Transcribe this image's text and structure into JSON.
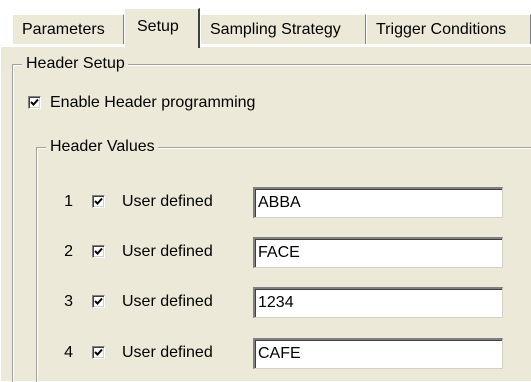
{
  "tabs": [
    {
      "label": "Parameters",
      "active": false
    },
    {
      "label": "Setup",
      "active": true
    },
    {
      "label": "Sampling Strategy",
      "active": false
    },
    {
      "label": "Trigger Conditions",
      "active": false
    }
  ],
  "header_setup": {
    "title": "Header Setup",
    "enable_label": "Enable Header programming",
    "enable_checked": true
  },
  "header_values": {
    "title": "Header Values",
    "rows": [
      {
        "num": "1",
        "label": "User defined",
        "checked": true,
        "value": "ABBA"
      },
      {
        "num": "2",
        "label": "User defined",
        "checked": true,
        "value": "FACE"
      },
      {
        "num": "3",
        "label": "User defined",
        "checked": true,
        "value": "1234"
      },
      {
        "num": "4",
        "label": "User defined",
        "checked": true,
        "value": "CAFE"
      }
    ]
  },
  "colors": {
    "dialog_background": "#ece9d8",
    "field_background": "#ffffff",
    "text": "#000000"
  },
  "icons": {
    "checkbox_mark": "check-mark-icon"
  }
}
